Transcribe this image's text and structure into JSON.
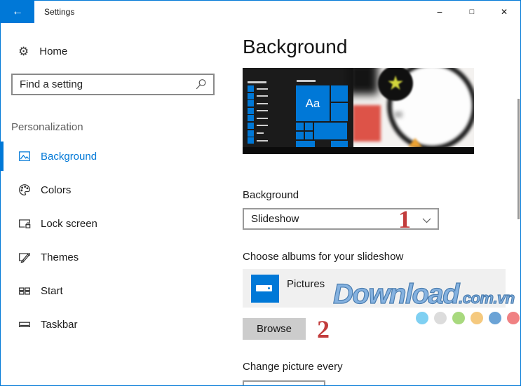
{
  "colors": {
    "accent": "#0078d7",
    "annotation_red": "#c23c3c",
    "watermark_blue": "#85b2e0",
    "watermark_stroke": "#4a7cae",
    "scrollbar": "#999999"
  },
  "titlebar": {
    "title": "Settings",
    "back_icon": "←",
    "minimize_icon": "−",
    "maximize_icon": "□",
    "close_icon": "✕"
  },
  "sidebar": {
    "home_label": "Home",
    "home_icon": "⚙",
    "search_placeholder": "Find a setting",
    "section_label": "Personalization",
    "items": [
      {
        "label": "Background",
        "selected": true
      },
      {
        "label": "Colors",
        "selected": false
      },
      {
        "label": "Lock screen",
        "selected": false
      },
      {
        "label": "Themes",
        "selected": false
      },
      {
        "label": "Start",
        "selected": false
      },
      {
        "label": "Taskbar",
        "selected": false
      }
    ]
  },
  "main": {
    "page_title": "Background",
    "preview_tile_text": "Aa",
    "preview_star_icon": "★",
    "background_section_label": "Background",
    "background_dropdown_value": "Slideshow",
    "annotation_1": "1",
    "albums_section_label": "Choose albums for your slideshow",
    "album_name": "Pictures",
    "browse_label": "Browse",
    "annotation_2": "2",
    "change_picture_label": "Change picture every"
  },
  "watermark": {
    "text": "Download",
    "suffix": ".com.vn",
    "dot_colors": [
      "#7fd0f2",
      "#dcdcdc",
      "#a8d97e",
      "#f5c97e",
      "#6ba3d6",
      "#f08183"
    ]
  }
}
